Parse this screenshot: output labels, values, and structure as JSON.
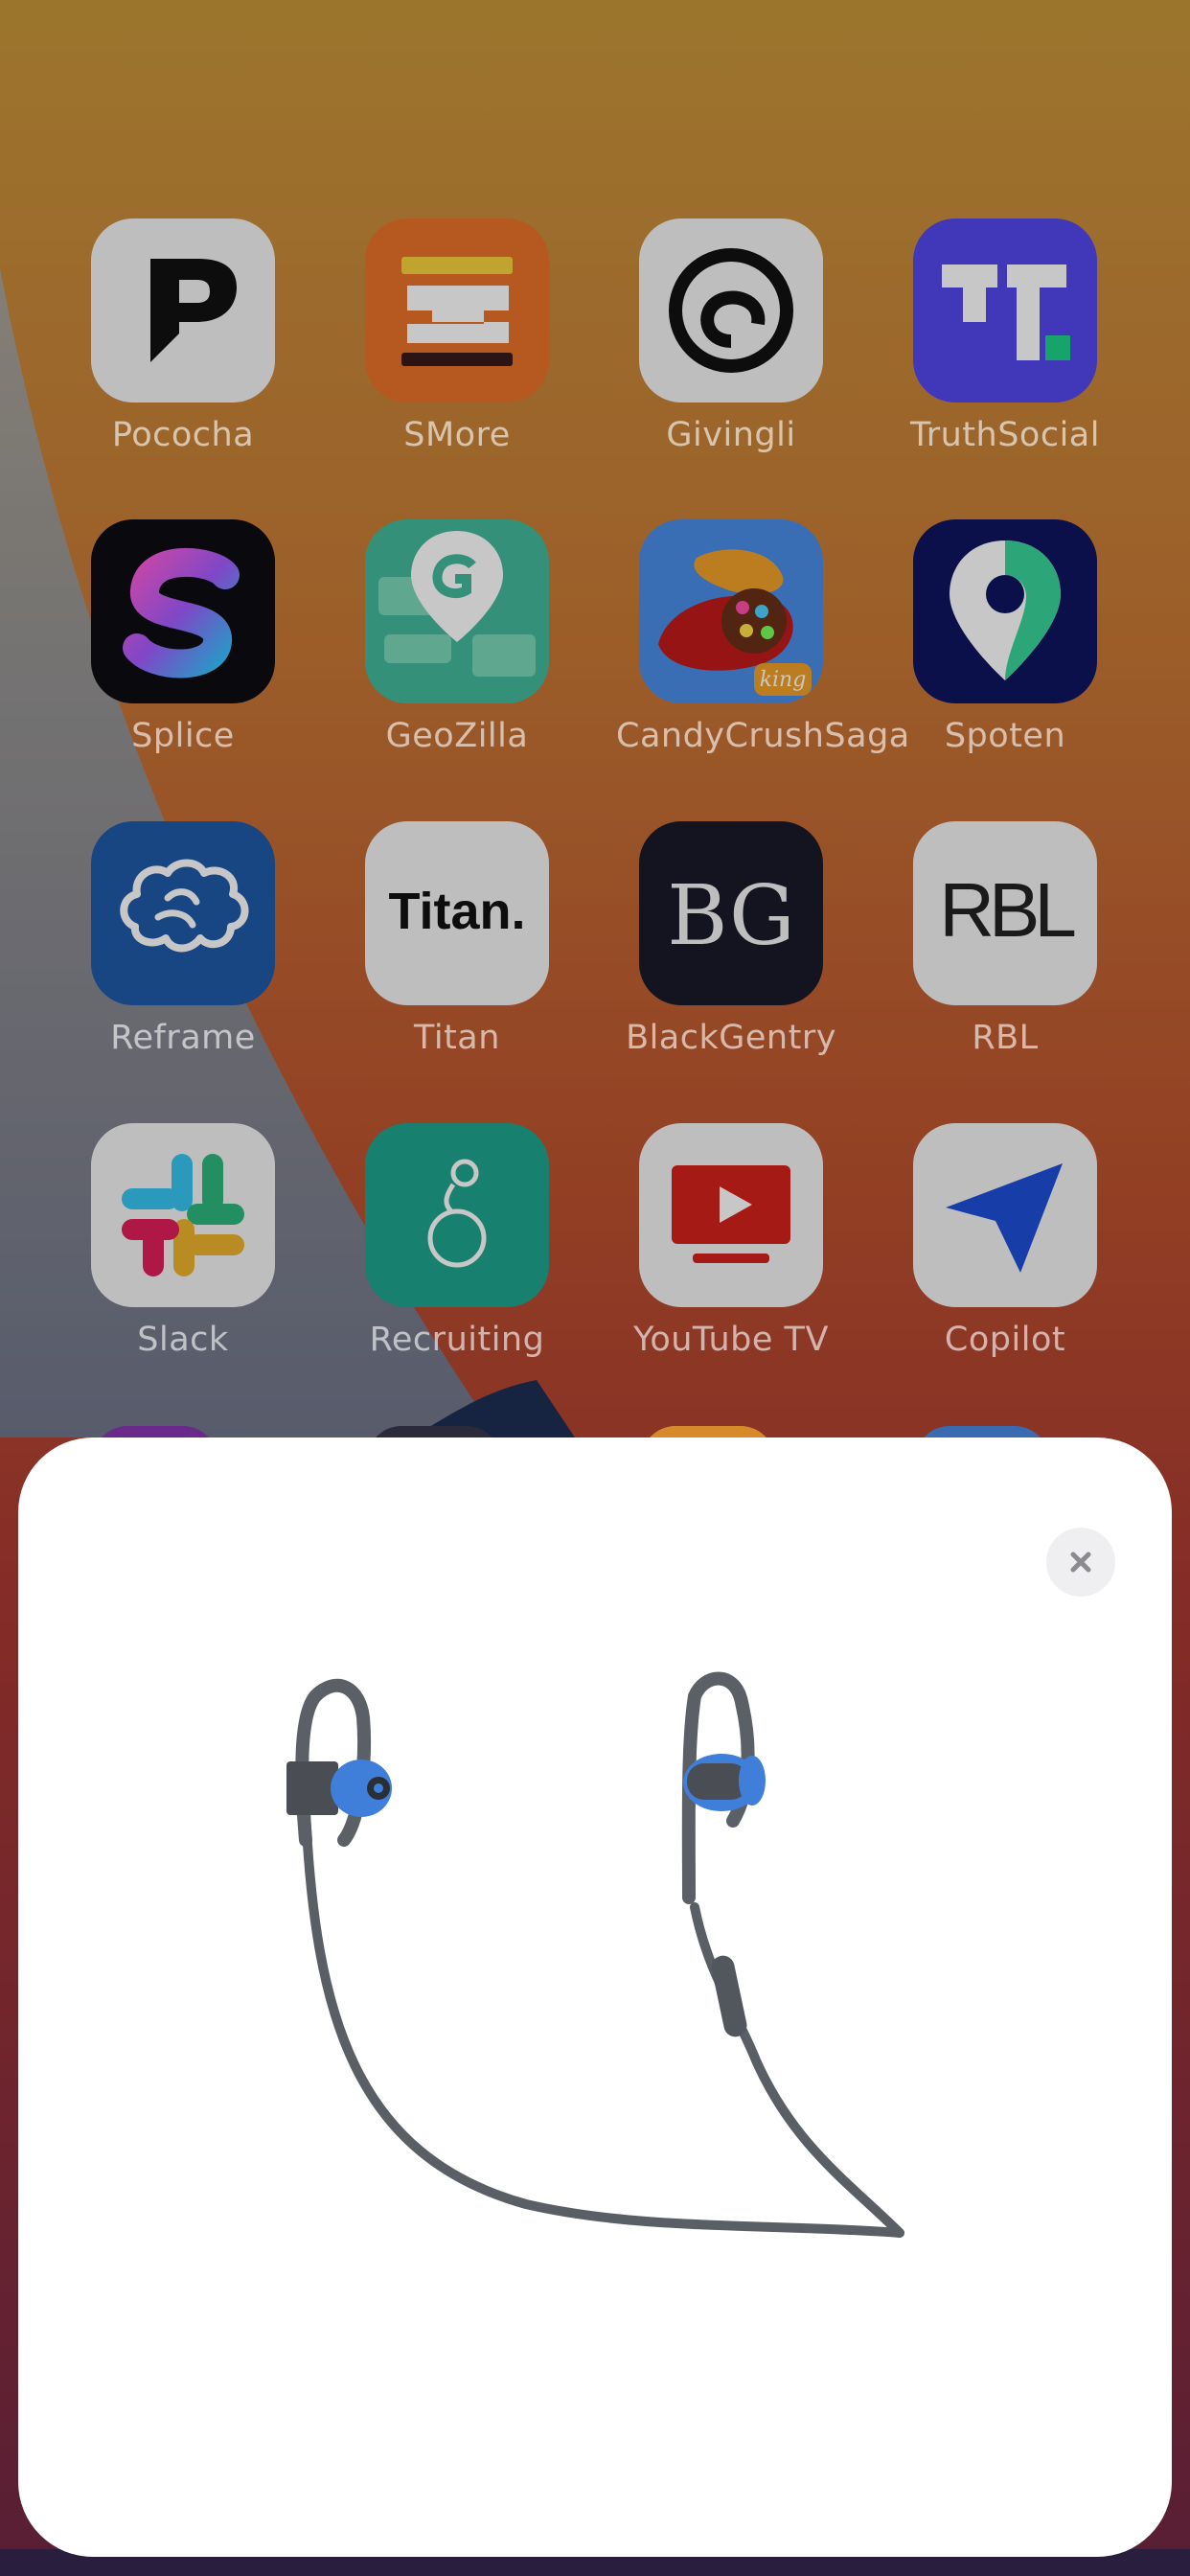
{
  "home_screen": {
    "apps": [
      {
        "name": "Pococha"
      },
      {
        "name": "SMore"
      },
      {
        "name": "Givingli"
      },
      {
        "name": "TruthSocial"
      },
      {
        "name": "Splice"
      },
      {
        "name": "GeoZilla"
      },
      {
        "name": "CandyCrushSaga",
        "badge_text": "king"
      },
      {
        "name": "Spoten"
      },
      {
        "name": "Reframe"
      },
      {
        "name": "Titan",
        "icon_text": "Titan."
      },
      {
        "name": "BlackGentry",
        "icon_text": "BG"
      },
      {
        "name": "RBL",
        "icon_text": "RBL"
      },
      {
        "name": "Slack"
      },
      {
        "name": "Recruiting"
      },
      {
        "name": "YouTube TV"
      },
      {
        "name": "Copilot"
      }
    ]
  },
  "device_sheet": {
    "close_icon": "close-icon",
    "product_image": "beats-wireless-earphones"
  },
  "colors": {
    "sheet_background": "#ffffff",
    "close_button_background": "#efeff2",
    "earbud_accent": "#3f7fd9",
    "cable": "#555a60"
  }
}
